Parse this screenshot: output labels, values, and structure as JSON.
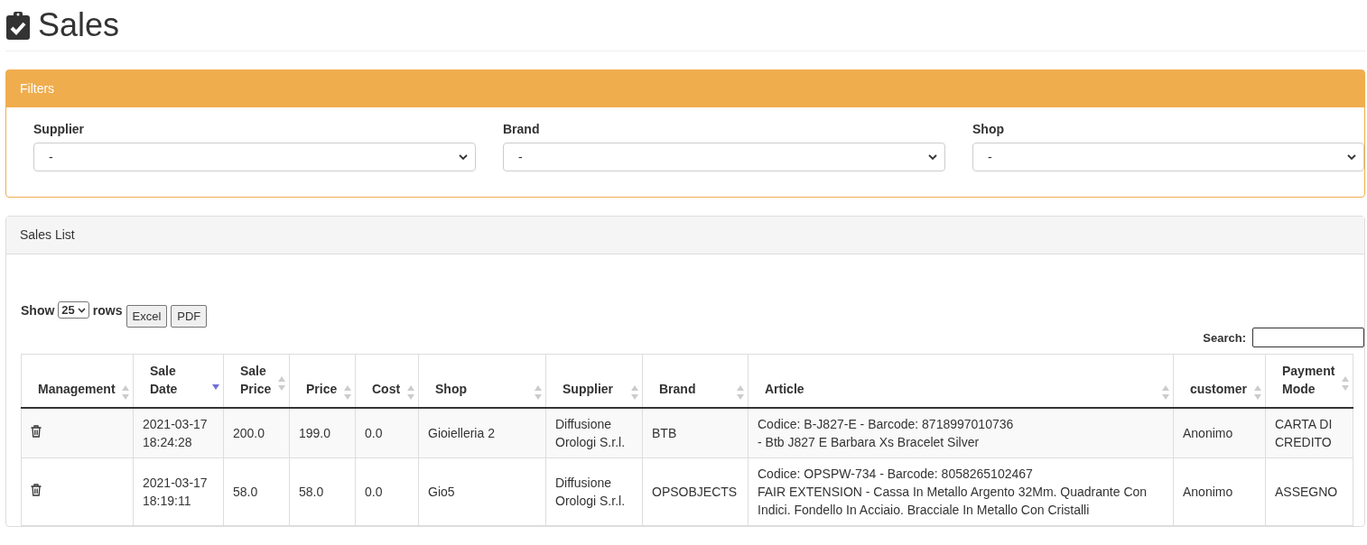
{
  "page": {
    "title": "Sales"
  },
  "filters": {
    "title": "Filters",
    "fields": [
      {
        "label": "Supplier",
        "value": "-"
      },
      {
        "label": "Brand",
        "value": "-"
      },
      {
        "label": "Shop",
        "value": "-"
      }
    ]
  },
  "sales_list": {
    "title": "Sales List",
    "length": {
      "label_before": "Show",
      "value": "25",
      "label_after": "rows"
    },
    "buttons": [
      "Excel",
      "PDF"
    ],
    "search": {
      "label": "Search:"
    },
    "columns": [
      {
        "label": "Management",
        "sorted": false
      },
      {
        "label": "Sale Date",
        "sorted": true
      },
      {
        "label": "Sale Price",
        "sorted": false
      },
      {
        "label": "Price",
        "sorted": false
      },
      {
        "label": "Cost",
        "sorted": false
      },
      {
        "label": "Shop",
        "sorted": false
      },
      {
        "label": "Supplier",
        "sorted": false
      },
      {
        "label": "Brand",
        "sorted": false
      },
      {
        "label": "Article",
        "sorted": false
      },
      {
        "label": "customer",
        "sorted": false
      },
      {
        "label": "Payment Mode",
        "sorted": false
      }
    ],
    "rows": [
      {
        "cells": [
          "",
          "2021-03-17 18:24:28",
          "200.0",
          "199.0",
          "0.0",
          "Gioielleria 2",
          "Diffusione Orologi S.r.l.",
          "BTB",
          "Codice: B-J827-E - Barcode: 8718997010736\n- Btb J827 E Barbara Xs Bracelet Silver",
          "Anonimo",
          "CARTA DI CREDITO"
        ]
      },
      {
        "cells": [
          "",
          "2021-03-17 18:19:11",
          "58.0",
          "58.0",
          "0.0",
          "Gio5",
          "Diffusione Orologi S.r.l.",
          "OPSOBJECTS",
          "Codice: OPSPW-734 - Barcode: 8058265102467\nFAIR EXTENSION - Cassa In Metallo Argento 32Mm. Quadrante Con Indici. Fondello In Acciaio. Bracciale In Metallo Con Cristalli",
          "Anonimo",
          "ASSEGNO"
        ]
      }
    ]
  }
}
